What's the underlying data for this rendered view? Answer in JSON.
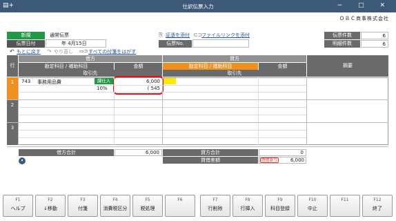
{
  "window": {
    "title": "仕訳伝票入力",
    "company": "ＯＢＣ商事株式会社",
    "controls": "− □ ✕"
  },
  "header": {
    "mode_badge": "新規",
    "voucher_type": "通常伝票",
    "date_label": "伝票日付",
    "date_value": "年 4月15日",
    "attach_cert": "証憑を添付",
    "attach_file_link": "ファイルリンクを添付",
    "voucher_no_label": "伝票No.",
    "undo_label": "もとに戻す",
    "redo_label": "やり直し",
    "remove_tags_label": "すべての付箋をはがす",
    "voucher_count_label": "伝票件数",
    "voucher_count": "6",
    "detail_count_label": "明細件数",
    "detail_count": "6"
  },
  "table": {
    "row_label": "行",
    "debit_label": "借方",
    "credit_label": "貸方",
    "account_label": "勘定科目 / 補助科目",
    "amount_label": "金額",
    "partner_label": "取引先",
    "summary_label": "摘要",
    "rows": [
      {
        "num": "1",
        "code": "743",
        "account": "事務用品費",
        "tax_tag": "課仕入",
        "amount": "6,000",
        "tax_rate": "10%",
        "tax_amount": "( 545"
      },
      {
        "num": "2"
      },
      {
        "num": "3"
      }
    ]
  },
  "totals": {
    "debit_total_label": "借方合計",
    "debit_total": "6,000",
    "credit_total_label": "貸方合計",
    "credit_total": "0",
    "diff_label": "貸借差額",
    "diff_tag": "貸借あり",
    "diff_value": "6,000"
  },
  "fkeys": [
    {
      "key": "F1",
      "label": "ヘルプ"
    },
    {
      "key": "F2",
      "label": "↓移動"
    },
    {
      "key": "F3",
      "label": "付箋"
    },
    {
      "key": "F4",
      "label": "消費税区分"
    },
    {
      "key": "F5",
      "label": "税処理"
    },
    {
      "key": "F6",
      "label": ""
    },
    {
      "key": "F7",
      "label": "行削除"
    },
    {
      "key": "F8",
      "label": "行挿入"
    },
    {
      "key": "F9",
      "label": "科目登録"
    },
    {
      "key": "F10",
      "label": "中止"
    },
    {
      "key": "F11",
      "label": ""
    },
    {
      "key": "F12",
      "label": "終了"
    }
  ]
}
